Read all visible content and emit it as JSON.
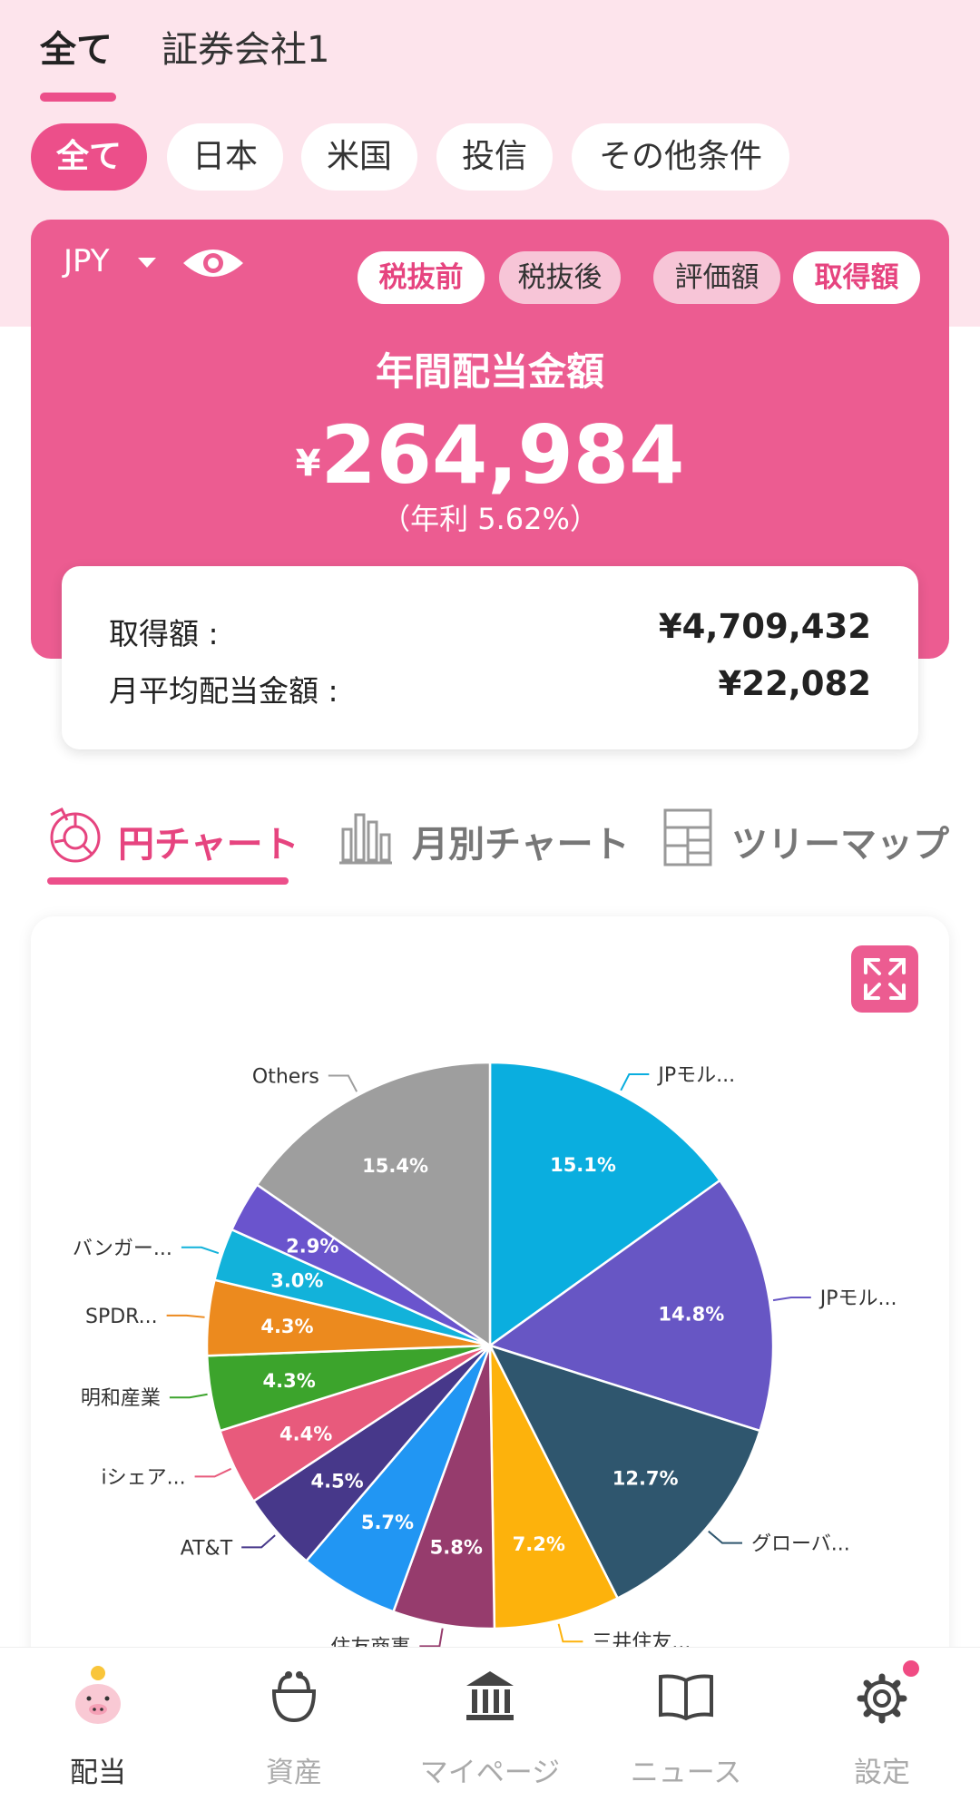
{
  "account_tabs": [
    {
      "label": "全て"
    },
    {
      "label": "証券会社1"
    }
  ],
  "filters": [
    {
      "label": "全て"
    },
    {
      "label": "日本"
    },
    {
      "label": "米国"
    },
    {
      "label": "投信"
    },
    {
      "label": "その他条件"
    }
  ],
  "summary": {
    "currency": "JPY",
    "tax_before": "税抜前",
    "tax_after": "税抜後",
    "valuation": "評価額",
    "acquisition": "取得額",
    "title": "年間配当金額",
    "amount_symbol": "¥",
    "amount": "264,984",
    "yield_text": "（年利 5.62%）"
  },
  "details": {
    "acq_label": "取得額 :",
    "acq_value": "¥4,709,432",
    "monthly_label": "月平均配当金額 :",
    "monthly_value": "¥22,082"
  },
  "chart_tabs": [
    {
      "label": "円チャート"
    },
    {
      "label": "月別チャート"
    },
    {
      "label": "ツリーマップ"
    }
  ],
  "chart_data": {
    "type": "pie",
    "categories": [
      "JPモル...",
      "JPモル...",
      "グローバ...",
      "三井住友...",
      "住友商事",
      "",
      "",
      "AT&T",
      "iシェア...",
      "明和産業",
      "SPDR...",
      "バンガー...",
      "",
      "Others"
    ],
    "values": [
      15.1,
      14.8,
      12.7,
      7.2,
      5.8,
      5.7,
      4.5,
      4.4,
      4.3,
      4.3,
      3.0,
      2.9,
      15.4
    ],
    "labels": [
      "JPモル...",
      "JPモル...",
      "グローバ...",
      "三井住友...",
      "住友商事",
      "",
      "AT&T",
      "iシェア...",
      "明和産業",
      "SPDR...",
      "バンガー...",
      "",
      "Others"
    ],
    "value_labels": [
      "15.1%",
      "14.8%",
      "12.7%",
      "7.2%",
      "5.8%",
      "5.7%",
      "4.5%",
      "4.4%",
      "4.3%",
      "4.3%",
      "3.0%",
      "2.9%",
      "15.4%"
    ],
    "colors": [
      "#0aaedf",
      "#6756c4",
      "#2f566e",
      "#fdb20c",
      "#963c6d",
      "#2196f3",
      "#47388a",
      "#e85a7c",
      "#3ca42c",
      "#ec8a1e",
      "#12b2da",
      "#6a54cd",
      "#9e9e9e"
    ]
  },
  "nav": [
    {
      "label": "配当"
    },
    {
      "label": "資産"
    },
    {
      "label": "マイページ"
    },
    {
      "label": "ニュース"
    },
    {
      "label": "設定"
    }
  ],
  "icons": {
    "eye": "eye-icon",
    "expand": "expand-icon",
    "pie": "pie-chart-icon",
    "bar": "bar-chart-icon",
    "tree": "treemap-icon",
    "pig": "piggy-bank-icon",
    "purse": "purse-icon",
    "bank": "bank-icon",
    "book": "book-icon",
    "gear": "gear-icon"
  },
  "theme": {
    "accent": "#ec4f8a",
    "card": "#ec5c91",
    "background": "#fde4ec"
  }
}
